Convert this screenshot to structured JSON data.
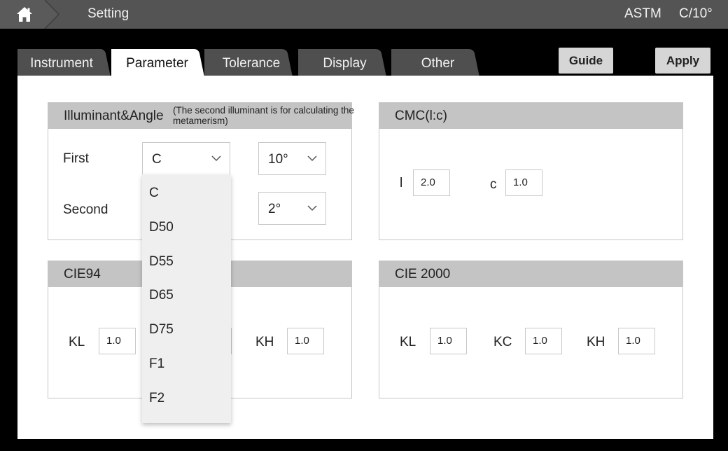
{
  "topbar": {
    "title": "Setting",
    "standard": "ASTM",
    "observer": "C/10°"
  },
  "tabs": [
    {
      "label": "Instrument",
      "active": false
    },
    {
      "label": "Parameter",
      "active": true
    },
    {
      "label": "Tolerance",
      "active": false
    },
    {
      "label": "Display",
      "active": false
    },
    {
      "label": "Other",
      "active": false
    }
  ],
  "actions": {
    "guide_label": "Guide",
    "apply_label": "Apply"
  },
  "illuminant": {
    "title": "Illuminant&Angle",
    "note": "(The second illuminant is for calculating the metamerism)",
    "first_label": "First",
    "second_label": "Second",
    "first_illuminant": "C",
    "first_angle": "10°",
    "second_angle": "2°",
    "dropdown_options": [
      "C",
      "D50",
      "D55",
      "D65",
      "D75",
      "F1",
      "F2"
    ]
  },
  "cmc": {
    "title": "CMC(l:c)",
    "l_label": "l",
    "l_value": "2.0",
    "c_label": "c",
    "c_value": "1.0"
  },
  "cie94": {
    "title": "CIE94",
    "kl_label": "KL",
    "kl_value": "1.0",
    "kh_label": "KH",
    "kh_value": "1.0"
  },
  "cie2000": {
    "title": "CIE 2000",
    "kl_label": "KL",
    "kl_value": "1.0",
    "kc_label": "KC",
    "kc_value": "1.0",
    "kh_label": "KH",
    "kh_value": "1.0"
  },
  "icons": {
    "home": "home-icon",
    "chevron": "chevron-down-icon"
  },
  "colors": {
    "topbar": "#545454",
    "tab_inactive": "#4f4f4f",
    "tab_active": "#ffffff",
    "group_header": "#c4c4c4",
    "button": "#d6d6d6",
    "dropdown": "#efefef"
  }
}
